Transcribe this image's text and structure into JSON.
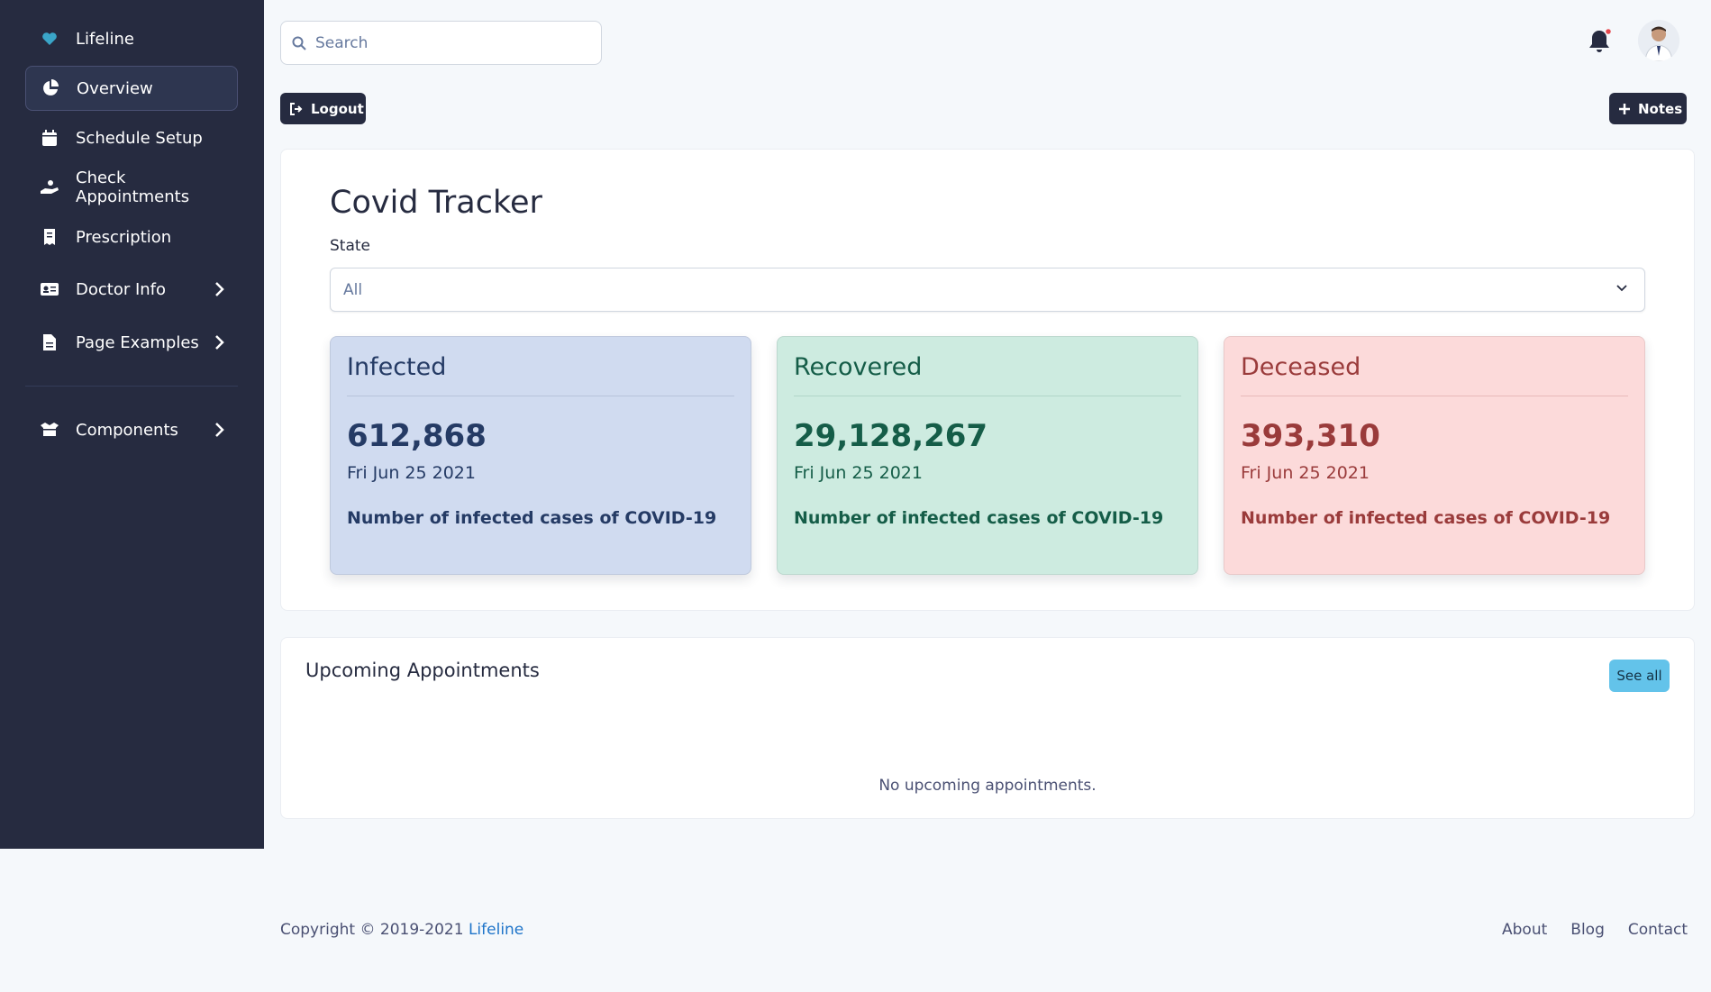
{
  "sidebar": {
    "brand": "Lifeline",
    "items": [
      {
        "label": "Overview",
        "icon": "pie-chart-icon",
        "active": true
      },
      {
        "label": "Schedule Setup",
        "icon": "calendar-icon"
      },
      {
        "label": "Check Appointments",
        "icon": "hand-holding-icon"
      },
      {
        "label": "Prescription",
        "icon": "receipt-icon"
      },
      {
        "label": "Doctor Info",
        "icon": "id-card-icon",
        "expandable": true
      },
      {
        "label": "Page Examples",
        "icon": "file-icon",
        "expandable": true
      },
      {
        "label": "Components",
        "icon": "box-open-icon",
        "expandable": true
      }
    ]
  },
  "search": {
    "placeholder": "Search",
    "value": ""
  },
  "toolbar": {
    "logout_label": "Logout",
    "notes_label": "Notes"
  },
  "covid": {
    "title": "Covid Tracker",
    "state_label": "State",
    "state_value": "All",
    "cards": [
      {
        "title": "Infected",
        "value": "612,868",
        "date": "Fri Jun 25 2021",
        "description": "Number of infected cases of COVID-19"
      },
      {
        "title": "Recovered",
        "value": "29,128,267",
        "date": "Fri Jun 25 2021",
        "description": "Number of infected cases of COVID-19"
      },
      {
        "title": "Deceased",
        "value": "393,310",
        "date": "Fri Jun 25 2021",
        "description": "Number of infected cases of COVID-19"
      }
    ]
  },
  "appointments": {
    "title": "Upcoming Appointments",
    "see_all_label": "See all",
    "empty_text": "No upcoming appointments."
  },
  "footer": {
    "copyright": "Copyright © 2019-2021 ",
    "brand": "Lifeline",
    "links": [
      "About",
      "Blog",
      "Contact"
    ]
  },
  "colors": {
    "sidebar_bg": "#262b40",
    "page_bg": "#f5f8fb",
    "infected_bg": "#d0dbf0",
    "recovered_bg": "#cdebe0",
    "deceased_bg": "#fcdada",
    "accent_info": "#63c3ea",
    "notification_dot": "#e5484d"
  }
}
